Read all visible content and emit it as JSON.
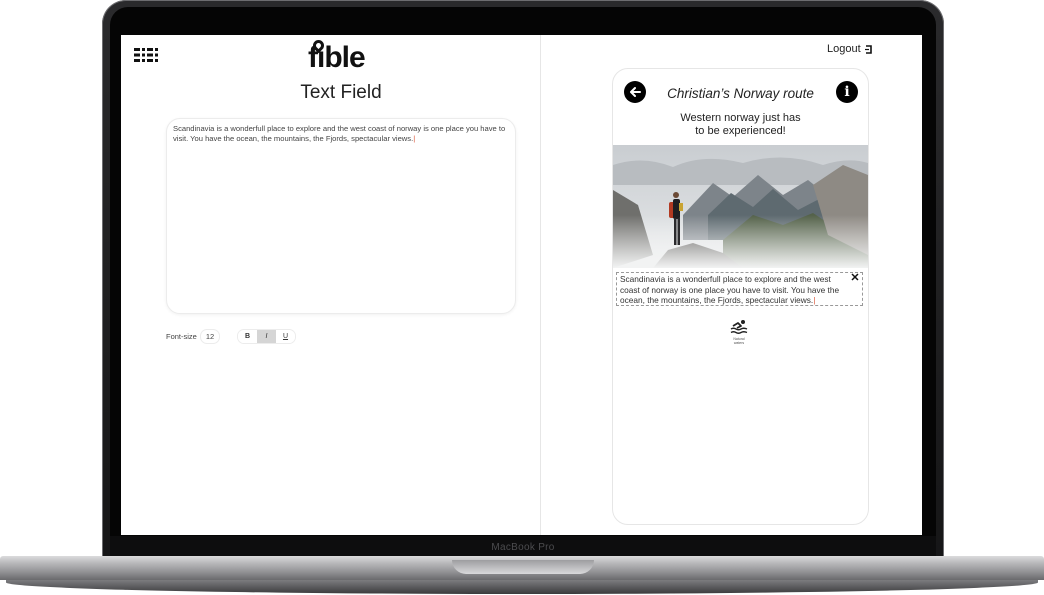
{
  "device": {
    "label": "MacBook Pro"
  },
  "header": {
    "logo_text": "fible",
    "logout_label": "Logout"
  },
  "editor": {
    "title": "Text Field",
    "content": "Scandinavia is a wonderfull place to explore and the west coast of norway is one place you have to visit. You have the ocean, the mountains, the Fjords, spectacular views.",
    "font_size_label": "Font-size",
    "font_size_value": "12",
    "format_buttons": {
      "bold": "B",
      "italic": "I",
      "underline": "U"
    }
  },
  "preview": {
    "route_title": "Christian’s Norway route",
    "subtitle_line1": "Western norway just has",
    "subtitle_line2": "to be experienced!",
    "description": "Scandinavia is a wonderfull place to explore and the west coast of norway is one place you have to visit. You have the ocean, the mountains, the Fjords, spectacular views.",
    "info_symbol": "i",
    "close_symbol": "✕",
    "activity_label_line1": "Natural",
    "activity_label_line2": "waters"
  },
  "icons": {
    "menu": "menu-grid-icon",
    "back": "arrow-left-icon",
    "info": "info-icon",
    "close": "close-icon",
    "logout": "logout-icon",
    "activity": "swimming-icon"
  },
  "colors": {
    "caret": "#d9563a",
    "text": "#222222",
    "italic_active_bg": "#d5d5d5"
  }
}
